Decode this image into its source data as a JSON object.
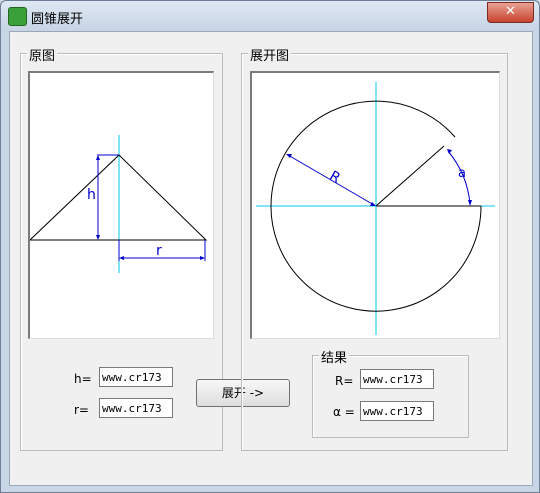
{
  "window": {
    "title": "圆锥展开",
    "close_label": "✕",
    "app_icon": "cone-app-icon"
  },
  "original": {
    "legend": "原图",
    "h_label": "h",
    "r_label": "r",
    "h_field_label": "h=",
    "r_field_label": "r=",
    "h_value": "www.cr173",
    "r_value": "www.cr173"
  },
  "expanded": {
    "legend": "展开图",
    "R_label": "R",
    "alpha_label": "a",
    "expand_button_label": "展开 ->",
    "result_legend": "结果",
    "R_field_label": "R=",
    "alpha_field_label": "α =",
    "R_value": "www.cr173",
    "alpha_value": "www.cr173"
  },
  "colors": {
    "axis": "#00c8e6",
    "dimension": "#0000cc",
    "shape": "#000000"
  }
}
